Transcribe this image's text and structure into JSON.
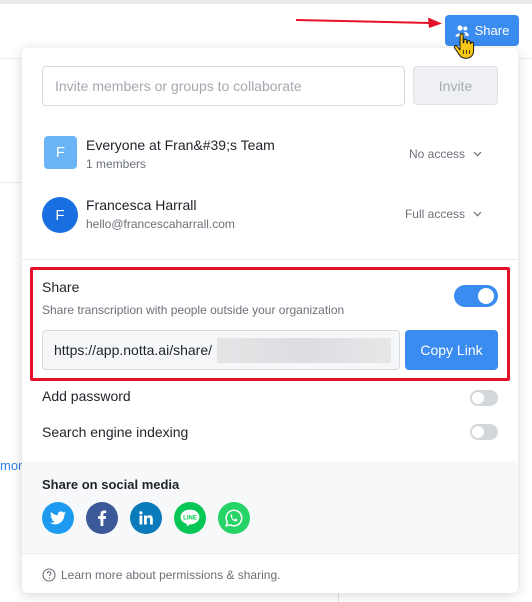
{
  "header": {
    "share_button_label": "Share"
  },
  "background": {
    "left_text": "mon"
  },
  "invite": {
    "placeholder": "Invite members or groups to collaborate",
    "button_label": "Invite"
  },
  "members": [
    {
      "avatar_letter": "F",
      "name": "Everyone at Fran&#39;s Team",
      "subtitle": "1 members",
      "access": "No access",
      "avatar_color": "#6ab4f7"
    },
    {
      "avatar_letter": "F",
      "name": "Francesca Harrall",
      "subtitle": "hello@francescaharrall.com",
      "access": "Full access",
      "avatar_color": "#1a6fe0"
    }
  ],
  "share_section": {
    "title": "Share",
    "description": "Share transcription with people outside your organization",
    "enabled": true,
    "link_prefix": "https://app.notta.ai/share/",
    "copy_button_label": "Copy Link"
  },
  "options": {
    "add_password": {
      "label": "Add password",
      "enabled": false
    },
    "search_engine_indexing": {
      "label": "Search engine indexing",
      "enabled": false
    }
  },
  "social": {
    "title": "Share on social media",
    "networks": [
      {
        "name": "twitter-icon",
        "color": "#1d9bf0"
      },
      {
        "name": "facebook-icon",
        "color": "#3b5998"
      },
      {
        "name": "linkedin-icon",
        "color": "#0a7bba"
      },
      {
        "name": "line-icon",
        "color": "#06c755"
      },
      {
        "name": "whatsapp-icon",
        "color": "#25d366"
      }
    ]
  },
  "footer": {
    "help_text": "Learn more about permissions & sharing."
  },
  "colors": {
    "accent": "#3b8cf0",
    "annotation_red": "#e5112a"
  }
}
